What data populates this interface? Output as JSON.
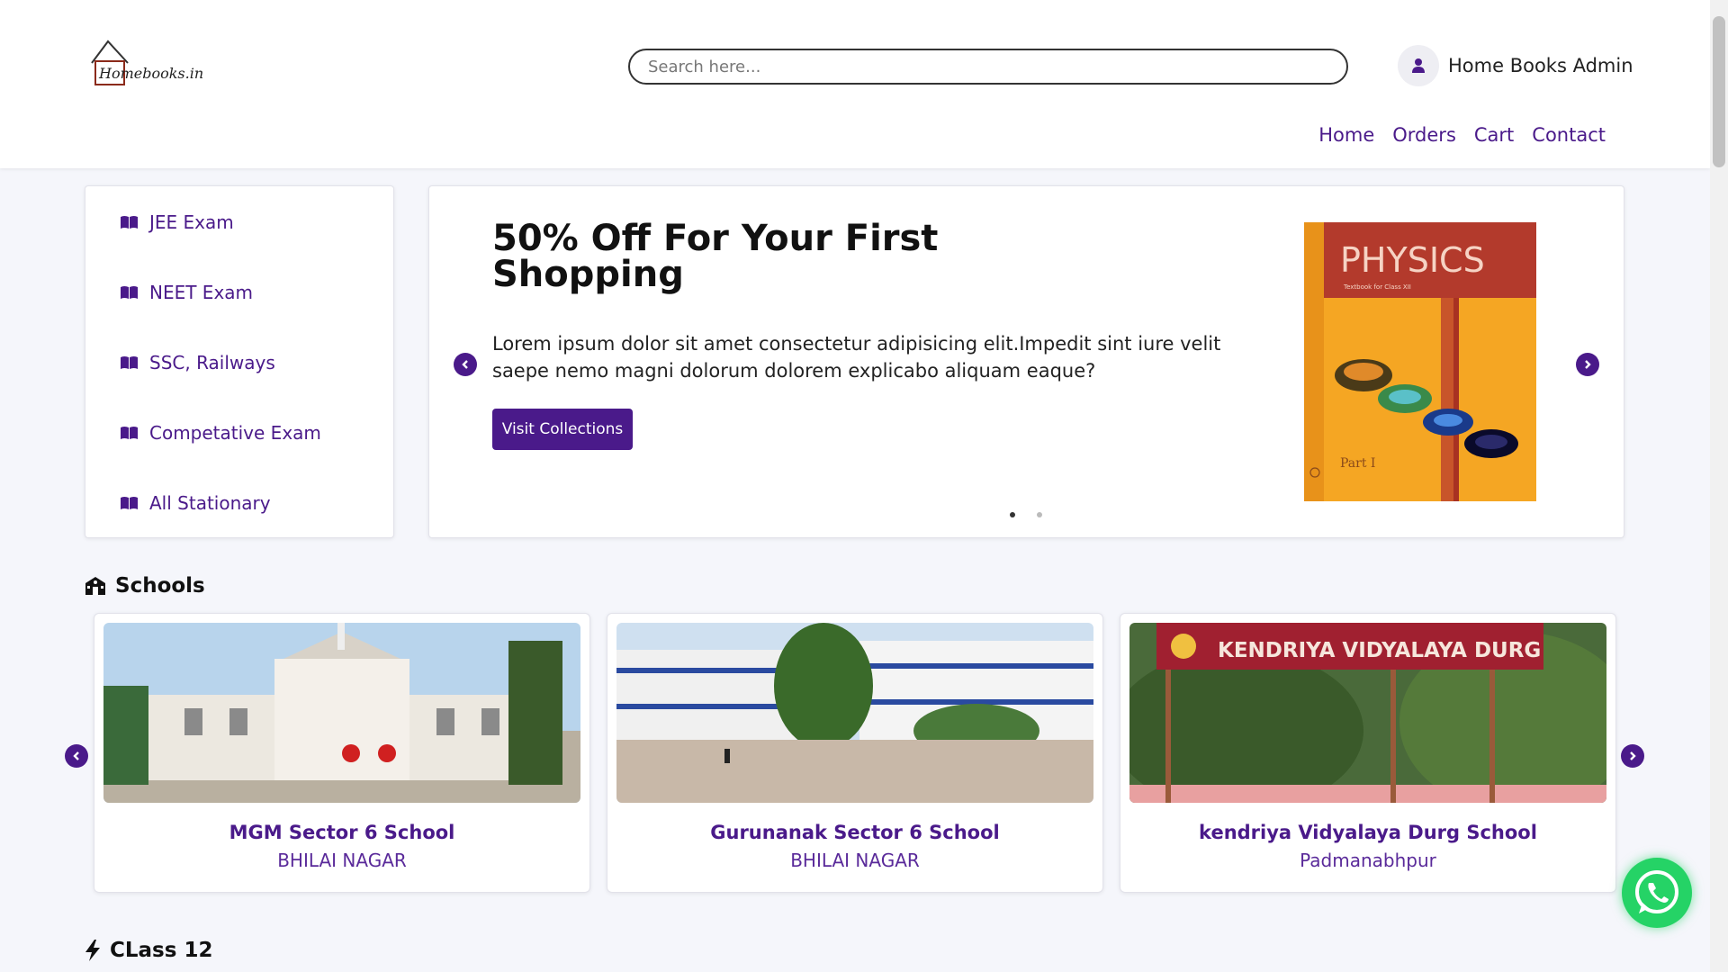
{
  "header": {
    "logo_text": "Homebooks.in",
    "search_placeholder": "Search here...",
    "user_name": "Home Books Admin",
    "nav": [
      "Home",
      "Orders",
      "Cart",
      "Contact"
    ]
  },
  "categories": [
    "JEE Exam",
    "NEET Exam",
    "SSC, Railways",
    "Competative Exam",
    "All Stationary"
  ],
  "hero": {
    "title": "50% Off For Your First Shopping",
    "text": "Lorem ipsum dolor sit amet consectetur adipisicing elit.Impedit sint iure velit saepe nemo magni dolorum dolorem explicabo aliquam eaque?",
    "button": "Visit Collections",
    "book_title": "PHYSICS",
    "book_subtitle": "Textbook for Class XII",
    "book_part": "Part I",
    "slide_count": 2,
    "active_slide": 1
  },
  "schools": {
    "title": "Schools",
    "items": [
      {
        "name": "MGM Sector 6 School",
        "location": "BHILAI NAGAR"
      },
      {
        "name": "Gurunanak Sector 6 School",
        "location": "BHILAI NAGAR"
      },
      {
        "name": "kendriya Vidyalaya Durg School",
        "location": "Padmanabhpur",
        "sign_text": "KENDRIYA VIDYALAYA DURG"
      }
    ]
  },
  "class12": {
    "title": "CLass 12"
  },
  "colors": {
    "accent": "#4a1a8a",
    "whatsapp": "#25d366"
  }
}
